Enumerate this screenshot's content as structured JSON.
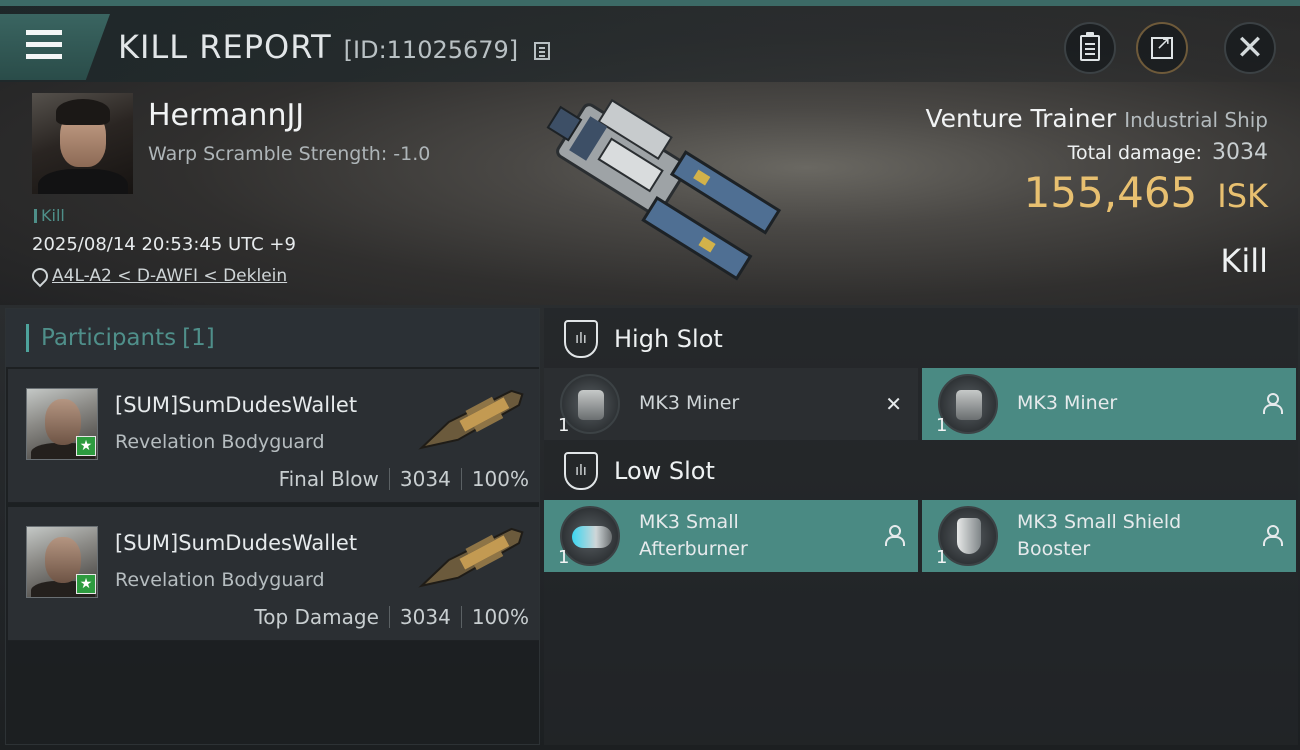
{
  "header": {
    "title": "KILL REPORT",
    "report_id": "[ID:11025679]",
    "menu_icon": "hamburger-menu-icon",
    "copy_icon": "copy-icon",
    "clipboard_icon": "clipboard-icon",
    "export_icon": "share-export-icon",
    "close_icon": "close-icon",
    "close_glyph": "✕"
  },
  "victim": {
    "name": "HermannJJ",
    "warp_scramble": "Warp Scramble Strength: -1.0",
    "kill_tag": "Kill",
    "datetime": "2025/08/14 20:53:45 UTC +9",
    "location": "A4L-A2 < D-AWFI < Deklein",
    "ship_name": "Venture Trainer",
    "ship_class": "Industrial Ship",
    "total_damage_label": "Total damage:",
    "total_damage_value": "3034",
    "isk_value": "155,465",
    "isk_unit": "ISK",
    "result": "Kill"
  },
  "participants": {
    "header_label": "Participants",
    "count": "[1]",
    "items": [
      {
        "name": "[SUM]SumDudesWallet",
        "ship": "Revelation Bodyguard",
        "role": "Final Blow",
        "damage": "3034",
        "percent": "100%",
        "badge": "★"
      },
      {
        "name": "[SUM]SumDudesWallet",
        "ship": "Revelation Bodyguard",
        "role": "Top Damage",
        "damage": "3034",
        "percent": "100%",
        "badge": "★"
      }
    ]
  },
  "slots": {
    "high": {
      "label": "High Slot",
      "modules": [
        {
          "qty": "1",
          "name": "MK3 Miner",
          "state": "destroyed",
          "status_glyph": "✕"
        },
        {
          "qty": "1",
          "name": "MK3 Miner",
          "state": "dropped"
        }
      ]
    },
    "low": {
      "label": "Low Slot",
      "modules": [
        {
          "qty": "1",
          "name_line1": "MK3 Small",
          "name_line2": "Afterburner",
          "state": "dropped"
        },
        {
          "qty": "1",
          "name_line1": "MK3 Small Shield",
          "name_line2": "Booster",
          "state": "dropped"
        }
      ]
    }
  },
  "colors": {
    "accent_teal": "#4a8a83",
    "isk_gold": "#e8c070",
    "badge_green": "#2d9b3f"
  }
}
